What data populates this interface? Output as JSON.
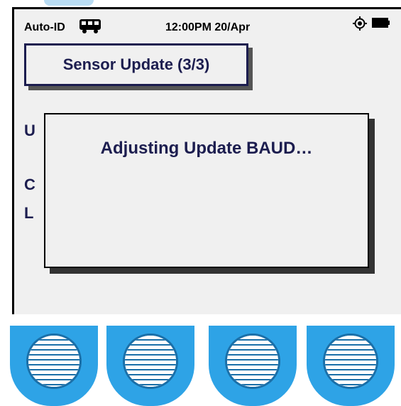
{
  "status_bar": {
    "network_label": "Auto-ID",
    "vehicle_icon": "bus-icon",
    "clock": "12:00PM 20/Apr",
    "gps_icon": "gps-target-icon",
    "battery_icon": "battery-icon"
  },
  "header": {
    "title": "Sensor Update (3/3)"
  },
  "background_text": {
    "line1": "U",
    "line2": "C",
    "line3": "L"
  },
  "dialog": {
    "message": "Adjusting Update BAUD…"
  },
  "softkeys": [
    {
      "icon": "speaker-grille-icon"
    },
    {
      "icon": "speaker-grille-icon"
    },
    {
      "icon": "speaker-grille-icon"
    },
    {
      "icon": "speaker-grille-icon"
    }
  ],
  "colors": {
    "screen_bg": "#f0f0f0",
    "text_navy": "#1c1d4f",
    "softkey_blue": "#2ea3e6",
    "grille_blue": "#1a6fa8"
  }
}
